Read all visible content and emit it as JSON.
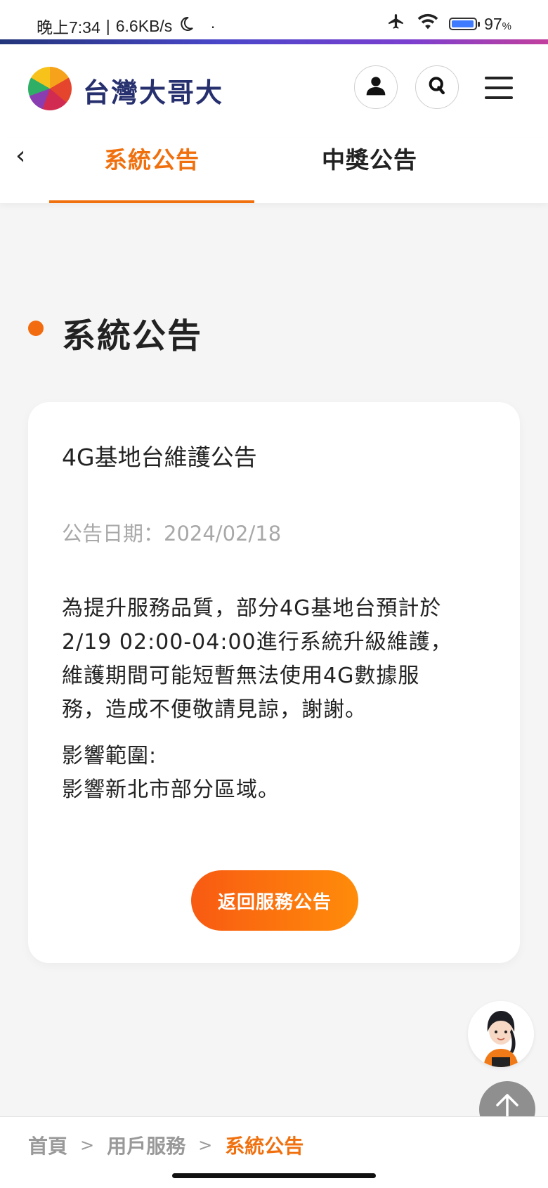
{
  "status_bar": {
    "time": "晚上7:34",
    "separator": "|",
    "speed": "6.6KB/s",
    "dot": "·",
    "battery": "97",
    "battery_unit": "%",
    "battery_level": 0.97,
    "icons": [
      "moon-icon",
      "airplane-icon",
      "wifi-icon",
      "battery-icon"
    ]
  },
  "header": {
    "brand": "台灣大哥大",
    "icons": [
      "user-icon",
      "search-icon",
      "menu-icon"
    ]
  },
  "tabs": [
    {
      "label": "系統公告",
      "active": true
    },
    {
      "label": "中獎公告",
      "active": false
    }
  ],
  "section": {
    "title": "系統公告"
  },
  "announcement": {
    "title": "4G基地台維護公告",
    "date": "公告日期：2024/02/18",
    "body_lines": [
      "為提升服務品質，部分4G基地台預計於",
      "2/19 02:00-04:00進行系統升級維護，",
      "維護期間可能短暫無法使用4G數據服",
      "務，造成不便敬請見諒，謝謝。"
    ],
    "impact_label": "影響範圍:",
    "impact_text": "影響新北市部分區域。",
    "return_button": "返回服務公告"
  },
  "breadcrumb": {
    "items": [
      "首頁",
      "用戶服務"
    ],
    "current": "系統公告",
    "separator": ">"
  },
  "colors": {
    "accent": "#f0700e",
    "brand_text": "#27306e",
    "button_start": "#f85a12",
    "button_end": "#ff8c0a"
  }
}
